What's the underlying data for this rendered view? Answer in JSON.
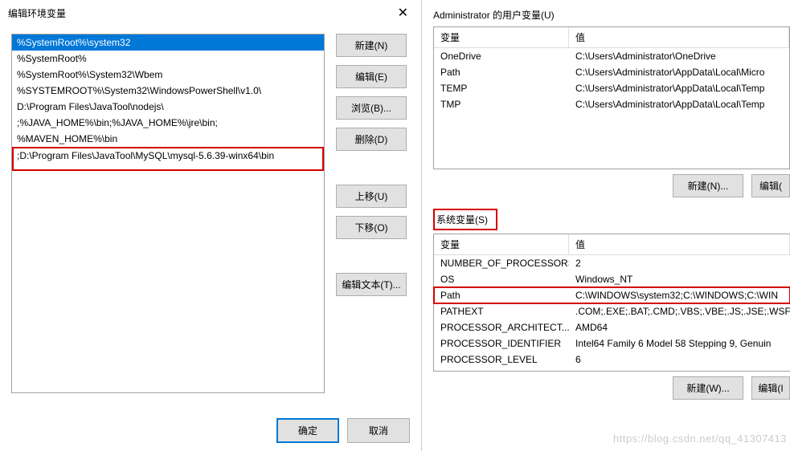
{
  "dialog": {
    "title": "编辑环境变量",
    "close": "✕",
    "list": [
      {
        "value": "%SystemRoot%\\system32",
        "selected": true
      },
      {
        "value": "%SystemRoot%"
      },
      {
        "value": "%SystemRoot%\\System32\\Wbem"
      },
      {
        "value": "%SYSTEMROOT%\\System32\\WindowsPowerShell\\v1.0\\"
      },
      {
        "value": "D:\\Program Files\\JavaTool\\nodejs\\"
      },
      {
        "value": ";%JAVA_HOME%\\bin;%JAVA_HOME%\\jre\\bin;"
      },
      {
        "value": "%MAVEN_HOME%\\bin"
      },
      {
        "value": ";D:\\Program Files\\JavaTool\\MySQL\\mysql-5.6.39-winx64\\bin",
        "highlighted": true
      }
    ],
    "buttons": {
      "new": "新建(N)",
      "edit": "编辑(E)",
      "browse": "浏览(B)...",
      "delete": "删除(D)",
      "up": "上移(U)",
      "down": "下移(O)",
      "edit_text": "编辑文本(T)...",
      "ok": "确定",
      "cancel": "取消"
    }
  },
  "right": {
    "user_title": "Administrator 的用户变量(U)",
    "sys_title": "系统变量(S)",
    "headers": {
      "var": "变量",
      "val": "值"
    },
    "user_vars": [
      {
        "k": "OneDrive",
        "v": "C:\\Users\\Administrator\\OneDrive"
      },
      {
        "k": "Path",
        "v": "C:\\Users\\Administrator\\AppData\\Local\\Micro"
      },
      {
        "k": "TEMP",
        "v": "C:\\Users\\Administrator\\AppData\\Local\\Temp"
      },
      {
        "k": "TMP",
        "v": "C:\\Users\\Administrator\\AppData\\Local\\Temp"
      }
    ],
    "sys_vars": [
      {
        "k": "NUMBER_OF_PROCESSORS",
        "v": "2"
      },
      {
        "k": "OS",
        "v": "Windows_NT"
      },
      {
        "k": "Path",
        "v": "C:\\WINDOWS\\system32;C:\\WINDOWS;C:\\WIN",
        "highlighted": true
      },
      {
        "k": "PATHEXT",
        "v": ".COM;.EXE;.BAT;.CMD;.VBS;.VBE;.JS;.JSE;.WSF;."
      },
      {
        "k": "PROCESSOR_ARCHITECT...",
        "v": "AMD64"
      },
      {
        "k": "PROCESSOR_IDENTIFIER",
        "v": "Intel64 Family 6 Model 58 Stepping 9, Genuin"
      },
      {
        "k": "PROCESSOR_LEVEL",
        "v": "6"
      }
    ],
    "buttons": {
      "new_n": "新建(N)...",
      "edit_e": "编辑(",
      "new_w": "新建(W)...",
      "edit_i": "编辑(I"
    }
  },
  "watermark": "https://blog.csdn.net/qq_41307413"
}
